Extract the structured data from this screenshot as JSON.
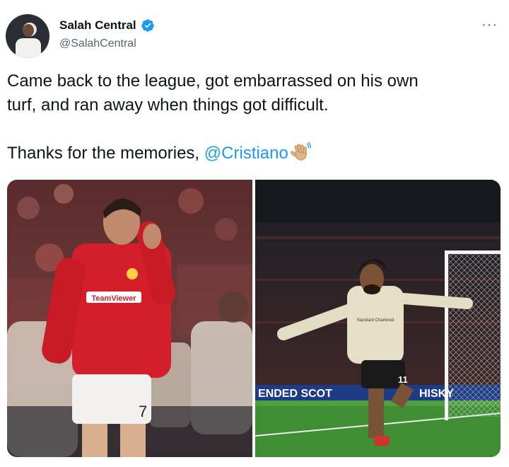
{
  "tweet": {
    "author_name": "Salah Central",
    "author_handle": "@SalahCentral",
    "text_line1": "Came back to the league, got embarrassed on his own",
    "text_line2": "turf, and ran away when things got difficult.",
    "text_line3_prefix": "Thanks for the memories, ",
    "mention": "@Cristiano",
    "more_label": "···"
  },
  "media": {
    "left_image": {
      "shirt_sponsor": "TeamViewer",
      "shirt_number": "7"
    },
    "right_image": {
      "board_text": "ENDED SCOT",
      "board_text_right": "HISKY",
      "shirt_number": "11",
      "shirt_sponsor": "Standard Chartered"
    }
  },
  "colors": {
    "verified": "#1d9bf0",
    "mention": "#1d9bf0",
    "handle": "#536471"
  },
  "icons": {
    "verified": "verified-badge-icon",
    "wave": "waving-hand-icon",
    "more": "more-options-icon"
  }
}
